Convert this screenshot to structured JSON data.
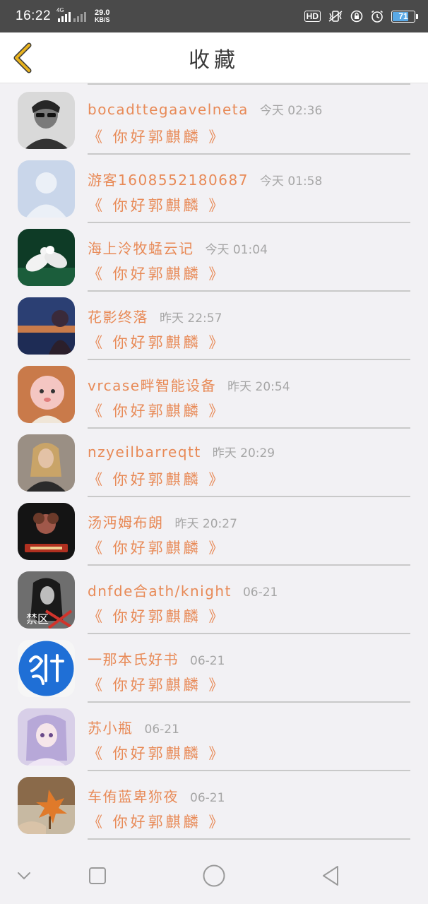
{
  "status_bar": {
    "time": "16:22",
    "network_type": "4G",
    "speed_value": "29.0",
    "speed_unit": "KB/S",
    "hd_label": "HD",
    "battery": "71"
  },
  "header": {
    "title": "收藏",
    "back_icon": "chevron-left-icon"
  },
  "favorites": [
    {
      "user": "bocadttegaavelneta",
      "time": "今天 02:36",
      "book": "《 你好郭麒麟 》",
      "avatar": "man-sunglasses"
    },
    {
      "user": "游客1608552180687",
      "time": "今天 01:58",
      "book": "《 你好郭麒麟 》",
      "avatar": "default-person"
    },
    {
      "user": "海上泠牧蜢云记",
      "time": "今天 01:04",
      "book": "《 你好郭麒麟 》",
      "avatar": "white-doves"
    },
    {
      "user": "花影终落",
      "time": "昨天 22:57",
      "book": "《 你好郭麒麟 》",
      "avatar": "sunset-girl"
    },
    {
      "user": "vrcase畔智能设备",
      "time": "昨天 20:54",
      "book": "《 你好郭麒麟 》",
      "avatar": "cartoon-baby"
    },
    {
      "user": "nzyeilbarreqtt",
      "time": "昨天 20:29",
      "book": "《 你好郭麒麟 》",
      "avatar": "blonde-woman"
    },
    {
      "user": "汤沔姆布朗",
      "time": "昨天 20:27",
      "book": "《 你好郭麒麟 》",
      "avatar": "cartoon-poster"
    },
    {
      "user": "dnfde合ath/knight",
      "time": "06-21",
      "book": "《 你好郭麒麟 》",
      "avatar": "dark-girl",
      "avatar_text": "禁区"
    },
    {
      "user": "一那本氏好书",
      "time": "06-21",
      "book": "《 你好郭麒麟 》",
      "avatar": "blue-circle-text"
    },
    {
      "user": "苏小瓶",
      "time": "06-21",
      "book": "《 你好郭麒麟 》",
      "avatar": "anime-girl"
    },
    {
      "user": "车侑蓝卑狝夜",
      "time": "06-21",
      "book": "《 你好郭麒麟 》",
      "avatar": "autumn-leaf"
    }
  ],
  "nav_bar": {
    "buttons": [
      "chevron-down-icon",
      "square-recents-icon",
      "circle-home-icon",
      "triangle-back-icon"
    ]
  },
  "colors": {
    "accent": "#e88a57",
    "back_chevron": "#e8b21e",
    "timestamp": "#a6a6a6",
    "status_bar": "#4a4a4a"
  }
}
